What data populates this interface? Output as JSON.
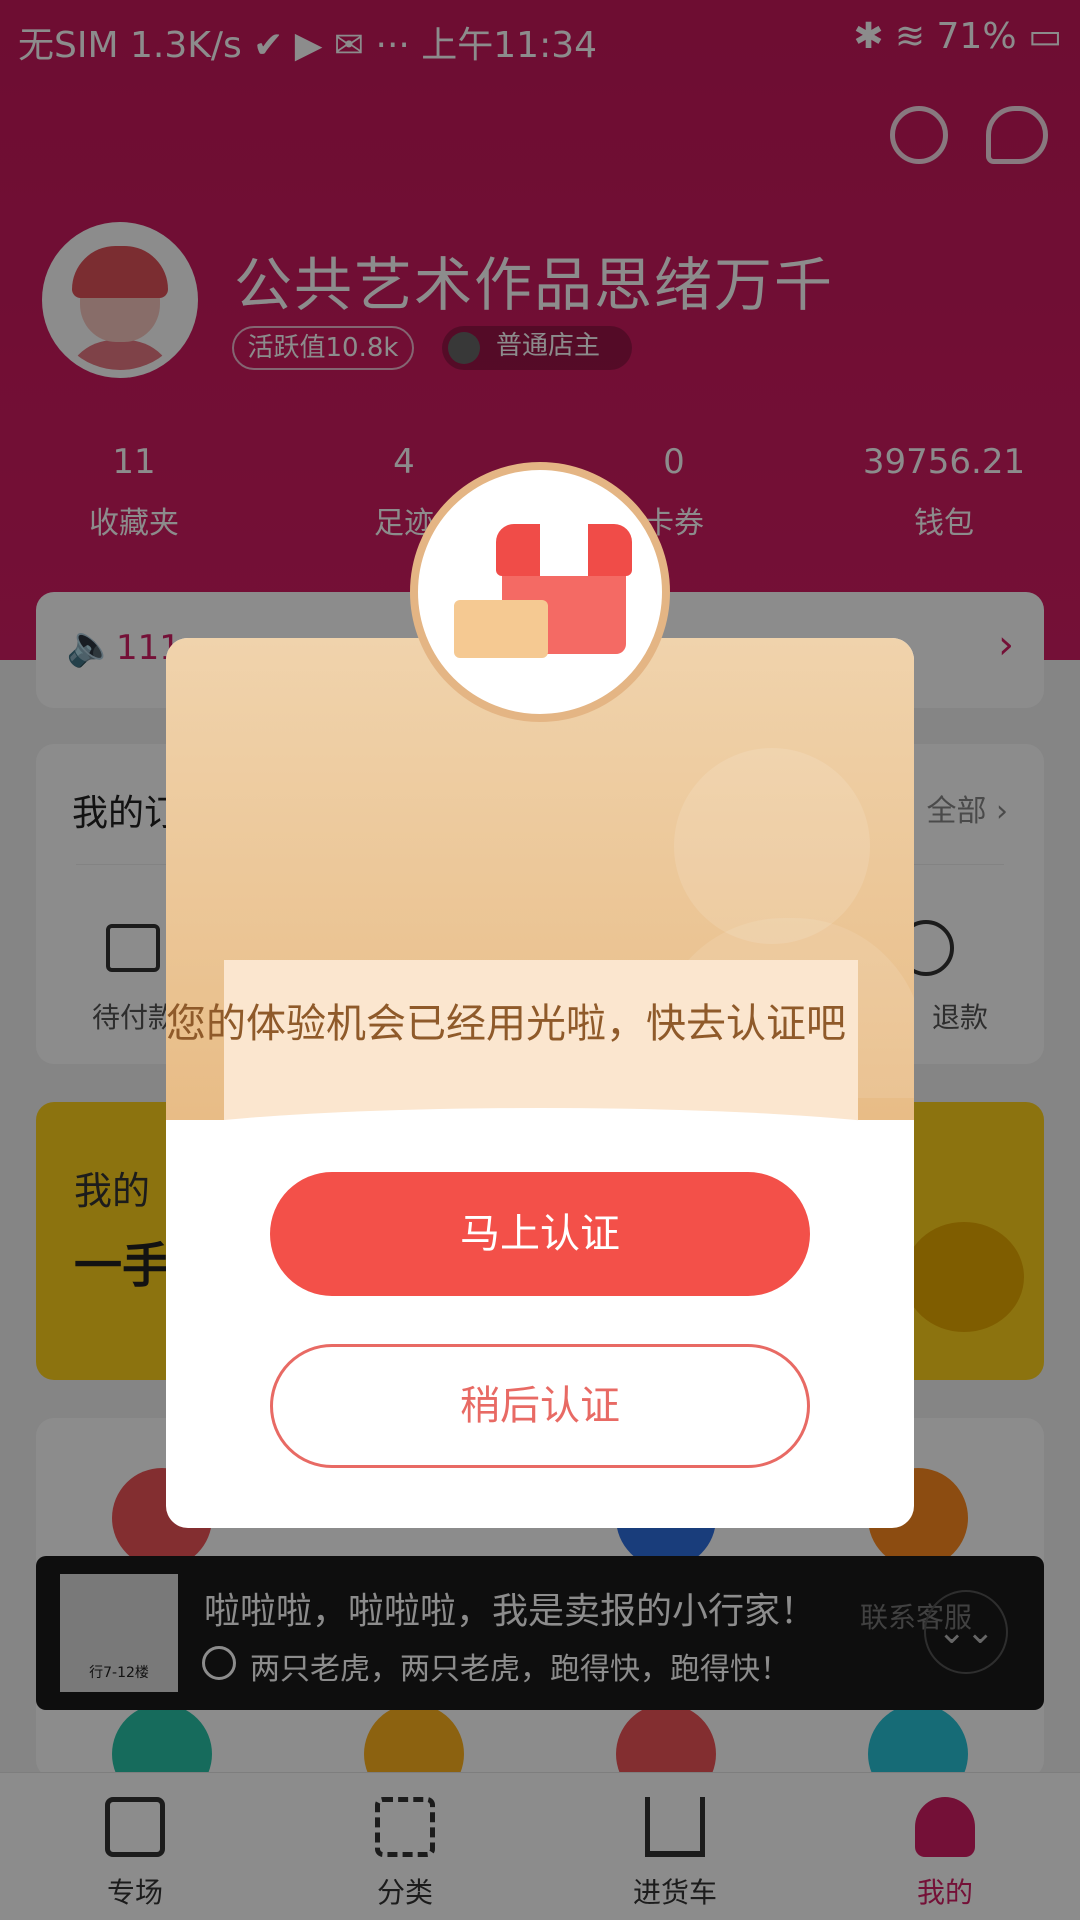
{
  "status_bar": {
    "left": "无SIM 1.3K/s ✔ ▶ ✉ ··· 上午11:34",
    "right": "✱ ≋ 71% ▭"
  },
  "profile": {
    "username": "公共艺术作品思绪万千",
    "activity_badge": "活跃值10.8k",
    "level_badge": "普通店主"
  },
  "stats": [
    {
      "value": "11",
      "label": "收藏夹"
    },
    {
      "value": "4",
      "label": "足迹"
    },
    {
      "value": "0",
      "label": "卡券"
    },
    {
      "value": "39756.21",
      "label": "钱包"
    }
  ],
  "notice": {
    "text": "111"
  },
  "orders": {
    "title": "我的订单",
    "more": "全部 ›",
    "item_left": "待付款",
    "item_right": "退款"
  },
  "promo": {
    "line1": "我的",
    "line2": "一手"
  },
  "music_bar": {
    "thumb_caption": "行7-12楼",
    "line1": "啦啦啦，啦啦啦，我是卖报的小行家！",
    "line2": "两只老虎，两只老虎，跑得快，跑得快！",
    "chevron": "⌄⌄",
    "hidden_label": "联系客服"
  },
  "tabs": [
    {
      "label": "专场",
      "icon": "calendar-icon"
    },
    {
      "label": "分类",
      "icon": "grid-icon"
    },
    {
      "label": "进货车",
      "icon": "cart-icon"
    },
    {
      "label": "我的",
      "icon": "user-icon"
    }
  ],
  "modal": {
    "message": "您的体验机会已经用光啦，快去认证吧",
    "primary_label": "马上认证",
    "secondary_label": "稍后认证"
  },
  "colors": {
    "brand": "#d41e64",
    "primary_button": "#f35049",
    "modal_top": "#e8bc86",
    "active_tab": "#d41e64"
  }
}
